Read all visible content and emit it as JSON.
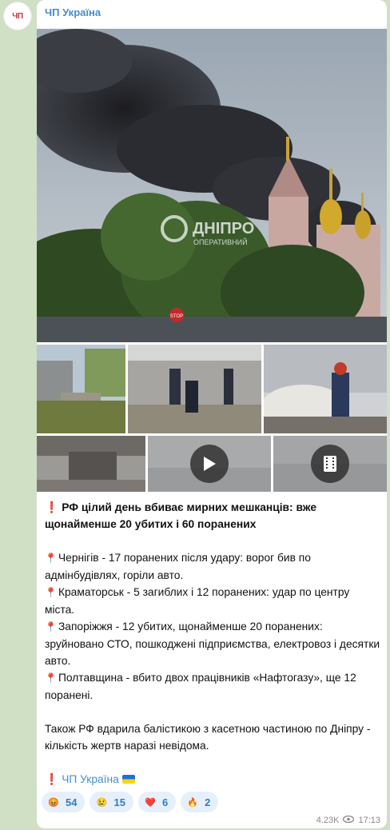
{
  "channel": {
    "name": "ЧП Україна",
    "avatar_text": "ЧП"
  },
  "media": {
    "watermark": "ДНІПРО",
    "watermark_sub": "ОПЕРАТИВНИЙ",
    "stop_sign": "STOP"
  },
  "post": {
    "title": "РФ цілий день вбиває мирних мешканців: вже щонайменше 20 убитих і 60 поранених",
    "items": [
      "Чернігів - 17 поранених після удару: ворог бив по адмінбудівлях, горіли авто.",
      "Краматорськ - 5 загиблих і 12 поранених: удар по центру міста.",
      "Запоріжжя - 12 убитих, щонайменше 20 поранених: зруйновано СТО, пошкоджені підприємства, електровоз і десятки авто.",
      "Полтавщина - вбито двох працівників «Нафтогазу», ще 12 поранені."
    ],
    "footer": "Також РФ вдарила балістикою з касетною частиною по Дніпру - кількість жертв наразі невідома.",
    "signature": "ЧП Україна"
  },
  "reactions": [
    {
      "icon": "angry-face-icon",
      "emoji": "😡",
      "count": "54"
    },
    {
      "icon": "sad-face-icon",
      "emoji": "😢",
      "count": "15"
    },
    {
      "icon": "heart-icon",
      "emoji": "❤️",
      "count": "6"
    },
    {
      "icon": "fire-icon",
      "emoji": "🔥",
      "count": "2"
    }
  ],
  "meta": {
    "views": "4.23K",
    "time": "17:13"
  }
}
